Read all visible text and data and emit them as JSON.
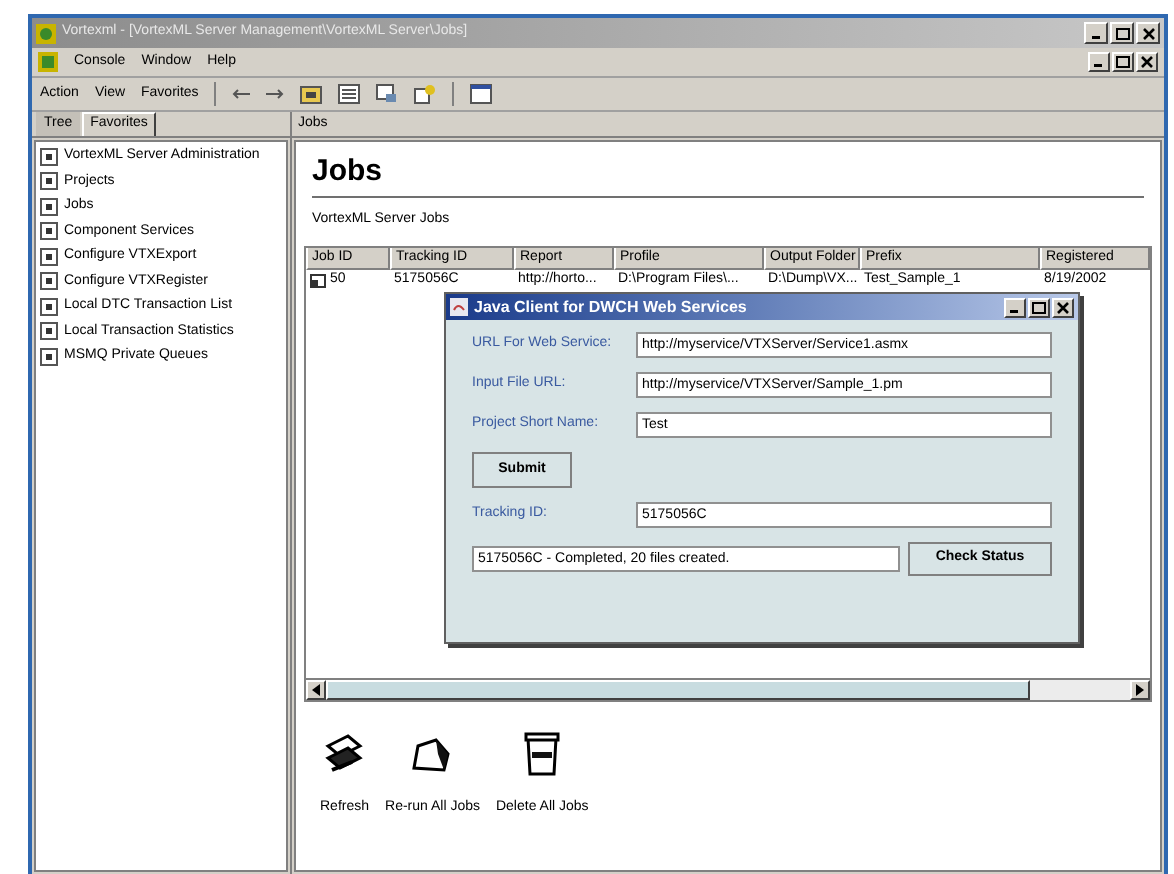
{
  "window": {
    "title": "Vortexml - [VortexML Server Management\\VortexML Server\\Jobs]"
  },
  "menu_bar": [
    "Console",
    "Window",
    "Help"
  ],
  "toolbar_menu": [
    "Action",
    "View",
    "Favorites"
  ],
  "tree_tabs": [
    {
      "label": "Tree",
      "selected": false
    },
    {
      "label": "Favorites",
      "selected": true
    }
  ],
  "tree_items": [
    "VortexML Server Administration",
    "Projects",
    "Jobs",
    "Component Services",
    "Configure VTXExport",
    "Configure VTXRegister",
    "Local DTC Transaction List",
    "Local Transaction Statistics",
    "MSMQ Private Queues"
  ],
  "pane_header": "Jobs",
  "heading": "Jobs",
  "subtitle": "VortexML Server Jobs",
  "table": {
    "columns": [
      "Job ID",
      "Tracking ID",
      "Report",
      "Profile",
      "Output Folder",
      "Prefix",
      "Registered"
    ],
    "rows": [
      [
        "50",
        "5175056C",
        "http://horto...",
        "D:\\Program Files\\...",
        "D:\\Dump\\VX...",
        "Test_Sample_1",
        "8/19/2002"
      ]
    ]
  },
  "dialog": {
    "title": "Java Client for DWCH Web Services",
    "fields": [
      {
        "label": "URL For Web Service:",
        "value": "http://myservice/VTXServer/Service1.asmx"
      },
      {
        "label": "Input File URL:",
        "value": "http://myservice/VTXServer/Sample_1.pm"
      },
      {
        "label": "Project Short Name:",
        "value": "Test"
      }
    ],
    "submit": "Submit",
    "tracking": {
      "label": "Tracking ID:",
      "value": "5175056C"
    },
    "status": "5175056C - Completed, 20 files created.",
    "check_button": "Check Status"
  },
  "actions": [
    {
      "kind": "refresh",
      "label": "Refresh"
    },
    {
      "kind": "rerun",
      "label": "Re-run All Jobs"
    },
    {
      "kind": "delete",
      "label": "Delete All Jobs"
    }
  ]
}
